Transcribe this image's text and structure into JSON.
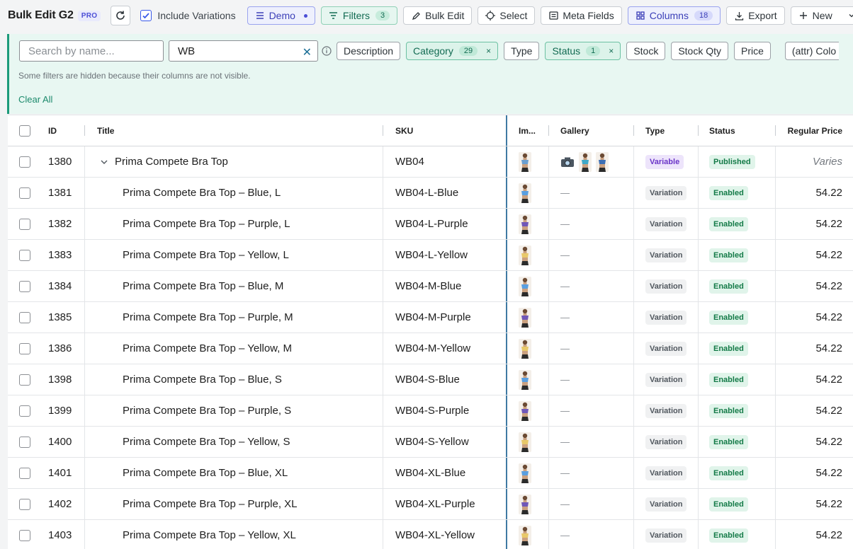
{
  "toolbar": {
    "title": "Bulk Edit G2",
    "pro_badge": "PRO",
    "include_variations_label": "Include Variations",
    "demo_label": "Demo",
    "filters_label": "Filters",
    "filters_count": "3",
    "bulk_edit_label": "Bulk Edit",
    "select_label": "Select",
    "meta_fields_label": "Meta Fields",
    "columns_label": "Columns",
    "columns_count": "18",
    "export_label": "Export",
    "new_label": "New"
  },
  "filters": {
    "name_placeholder": "Search by name...",
    "sku_value": "WB",
    "chips": [
      {
        "label": "Description"
      },
      {
        "label": "Category",
        "count": "29",
        "active": true
      },
      {
        "label": "Type"
      },
      {
        "label": "Status",
        "count": "1",
        "active": true
      },
      {
        "label": "Stock"
      },
      {
        "label": "Stock Qty"
      },
      {
        "label": "Price"
      },
      {
        "label": "(attr) Colo"
      }
    ],
    "hint": "Some filters are hidden because their columns are not visible.",
    "clear_all": "Clear All"
  },
  "table": {
    "headers": {
      "id": "ID",
      "title": "Title",
      "sku": "SKU",
      "image": "Im...",
      "gallery": "Gallery",
      "type": "Type",
      "status": "Status",
      "price": "Regular Price"
    },
    "rows": [
      {
        "id": "1380",
        "title": "Prima Compete Bra Top",
        "sku": "WB04",
        "type": "Variable",
        "status": "Published",
        "price": "Varies",
        "parent": true,
        "color": "#6a9fd1"
      },
      {
        "id": "1381",
        "title": "Prima Compete Bra Top – Blue, L",
        "sku": "WB04-L-Blue",
        "type": "Variation",
        "status": "Enabled",
        "price": "54.22",
        "color": "#5a9fe0"
      },
      {
        "id": "1382",
        "title": "Prima Compete Bra Top – Purple, L",
        "sku": "WB04-L-Purple",
        "type": "Variation",
        "status": "Enabled",
        "price": "54.22",
        "color": "#7058b8"
      },
      {
        "id": "1383",
        "title": "Prima Compete Bra Top – Yellow, L",
        "sku": "WB04-L-Yellow",
        "type": "Variation",
        "status": "Enabled",
        "price": "54.22",
        "color": "#e8c86a"
      },
      {
        "id": "1384",
        "title": "Prima Compete Bra Top – Blue, M",
        "sku": "WB04-M-Blue",
        "type": "Variation",
        "status": "Enabled",
        "price": "54.22",
        "color": "#5a9fe0"
      },
      {
        "id": "1385",
        "title": "Prima Compete Bra Top – Purple, M",
        "sku": "WB04-M-Purple",
        "type": "Variation",
        "status": "Enabled",
        "price": "54.22",
        "color": "#7058b8"
      },
      {
        "id": "1386",
        "title": "Prima Compete Bra Top – Yellow, M",
        "sku": "WB04-M-Yellow",
        "type": "Variation",
        "status": "Enabled",
        "price": "54.22",
        "color": "#e8c86a"
      },
      {
        "id": "1398",
        "title": "Prima Compete Bra Top – Blue, S",
        "sku": "WB04-S-Blue",
        "type": "Variation",
        "status": "Enabled",
        "price": "54.22",
        "color": "#5a9fe0"
      },
      {
        "id": "1399",
        "title": "Prima Compete Bra Top – Purple, S",
        "sku": "WB04-S-Purple",
        "type": "Variation",
        "status": "Enabled",
        "price": "54.22",
        "color": "#7058b8"
      },
      {
        "id": "1400",
        "title": "Prima Compete Bra Top – Yellow, S",
        "sku": "WB04-S-Yellow",
        "type": "Variation",
        "status": "Enabled",
        "price": "54.22",
        "color": "#e8c86a"
      },
      {
        "id": "1401",
        "title": "Prima Compete Bra Top – Blue, XL",
        "sku": "WB04-XL-Blue",
        "type": "Variation",
        "status": "Enabled",
        "price": "54.22",
        "color": "#5a9fe0"
      },
      {
        "id": "1402",
        "title": "Prima Compete Bra Top – Purple, XL",
        "sku": "WB04-XL-Purple",
        "type": "Variation",
        "status": "Enabled",
        "price": "54.22",
        "color": "#7058b8"
      },
      {
        "id": "1403",
        "title": "Prima Compete Bra Top – Yellow, XL",
        "sku": "WB04-XL-Yellow",
        "type": "Variation",
        "status": "Enabled",
        "price": "54.22",
        "color": "#e8c86a"
      }
    ],
    "empty_gallery": "—"
  }
}
